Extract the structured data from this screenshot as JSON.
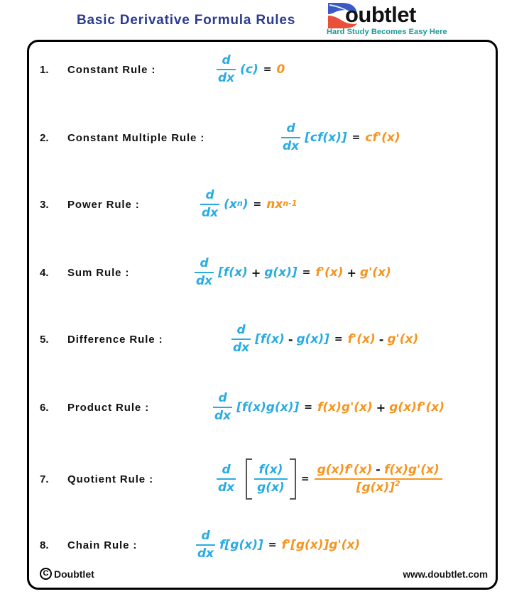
{
  "header": {
    "title": "Basic Derivative Formula Rules",
    "brand_word": "oubtlet",
    "brand_letter": "D",
    "tagline": "Hard Study Becomes Easy Here",
    "title_color": "#2b3b8f",
    "tagline_color": "#1a9a96"
  },
  "colors": {
    "blue": "#29abe2",
    "orange": "#f7941e",
    "black": "#111111",
    "bracket_gray": "#555555",
    "border": "#000000"
  },
  "rules": [
    {
      "number": "1.",
      "name": "Constant Rule :",
      "d": "d",
      "dx": "dx",
      "lhs": "(c)",
      "eq": "=",
      "rhs": "0"
    },
    {
      "number": "2.",
      "name": "Constant Multiple Rule :",
      "d": "d",
      "dx": "dx",
      "lhs": "[cf(x)]",
      "eq": "=",
      "rhs": "cf'(x)"
    },
    {
      "number": "3.",
      "name": "Power Rule :",
      "d": "d",
      "dx": "dx",
      "lhs_base": "(x",
      "lhs_exp": "n",
      "lhs_tail": ")",
      "eq": "=",
      "rhs_base": "nx",
      "rhs_exp": "n-1"
    },
    {
      "number": "4.",
      "name": "Sum Rule :",
      "d": "d",
      "dx": "dx",
      "lhs_a": "[f(x)",
      "lhs_op": "+",
      "lhs_b": "g(x)]",
      "eq": "=",
      "rhs_a": "f'(x)",
      "rhs_op": "+",
      "rhs_b": "g'(x)"
    },
    {
      "number": "5.",
      "name": "Difference Rule :",
      "d": "d",
      "dx": "dx",
      "lhs_a": "[f(x)",
      "lhs_op": "-",
      "lhs_b": "g(x)]",
      "eq": "=",
      "rhs_a": "f'(x)",
      "rhs_op": "-",
      "rhs_b": "g'(x)"
    },
    {
      "number": "6.",
      "name": "Product Rule :",
      "d": "d",
      "dx": "dx",
      "lhs": "[f(x)g(x)]",
      "eq": "=",
      "rhs_a": "f(x)g'(x)",
      "rhs_op": "+",
      "rhs_b": "g(x)f'(x)"
    },
    {
      "number": "7.",
      "name": "Quotient Rule :",
      "d": "d",
      "dx": "dx",
      "lhs_num": "f(x)",
      "lhs_den": "g(x)",
      "eq": "=",
      "rhs_num_a": "g(x)f'(x)",
      "rhs_num_op": "-",
      "rhs_num_b": "f(x)g'(x)",
      "rhs_den": "[g(x)]",
      "rhs_den_exp": "2"
    },
    {
      "number": "8.",
      "name": "Chain Rule :",
      "d": "d",
      "dx": "dx",
      "lhs": "f[g(x)]",
      "eq": "=",
      "rhs": "f'[g(x)]g'(x)"
    }
  ],
  "footer": {
    "copyright_symbol": "C",
    "copyright_name": "Doubtlet",
    "website": "www.doubtlet.com"
  }
}
